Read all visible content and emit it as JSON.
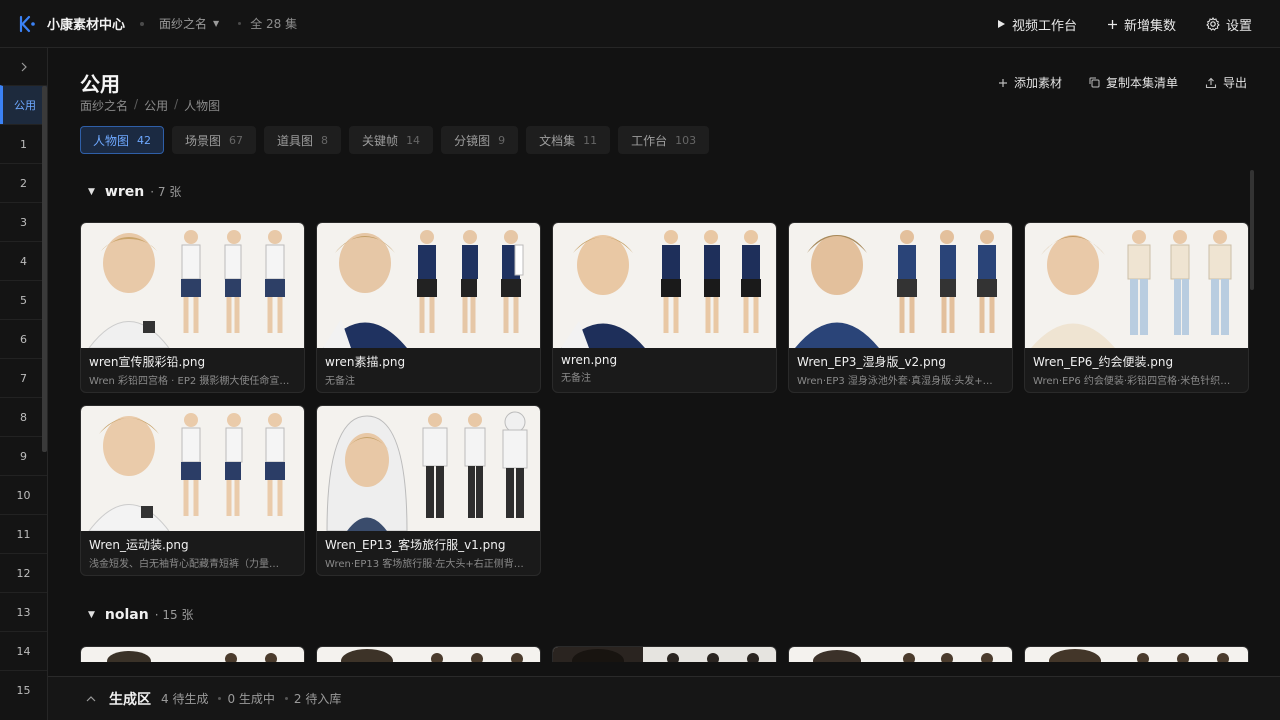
{
  "header": {
    "app_title": "小康素材中心",
    "project": "面纱之名",
    "episodes": "全 28 集",
    "actions": [
      {
        "label": "视频工作台",
        "icon": "play-icon"
      },
      {
        "label": "新增集数",
        "icon": "plus-icon"
      },
      {
        "label": "设置",
        "icon": "gear-icon"
      }
    ]
  },
  "sidebar": {
    "items": [
      "公用",
      "1",
      "2",
      "3",
      "4",
      "5",
      "6",
      "7",
      "8",
      "9",
      "10",
      "11",
      "12",
      "13",
      "14",
      "15"
    ]
  },
  "page": {
    "title": "公用",
    "breadcrumb": [
      "面纱之名",
      "公用",
      "人物图"
    ],
    "actions": [
      {
        "label": "添加素材",
        "icon": "plus-icon"
      },
      {
        "label": "复制本集清单",
        "icon": "copy-icon"
      },
      {
        "label": "导出",
        "icon": "export-icon"
      }
    ]
  },
  "tabs": [
    {
      "label": "人物图",
      "count": "42"
    },
    {
      "label": "场景图",
      "count": "67"
    },
    {
      "label": "道具图",
      "count": "8"
    },
    {
      "label": "关键帧",
      "count": "14"
    },
    {
      "label": "分镜图",
      "count": "9"
    },
    {
      "label": "文档集",
      "count": "11"
    },
    {
      "label": "工作台",
      "count": "103"
    }
  ],
  "groups": [
    {
      "name": "wren",
      "count": "· 7 张",
      "cards": [
        {
          "file": "wren宣传服彩铅.png",
          "note": "Wren 彩铅四宫格 · EP2 摄影棚大使任命宣…"
        },
        {
          "file": "wren素描.png",
          "note": "无备注"
        },
        {
          "file": "wren.png",
          "note": "无备注"
        },
        {
          "file": "Wren_EP3_湿身版_v2.png",
          "note": "Wren·EP3 湿身泳池外套·真湿身版·头发+…"
        },
        {
          "file": "Wren_EP6_约会便装.png",
          "note": "Wren·EP6 约会便装·彩铅四宫格·米色针织…"
        },
        {
          "file": "Wren_运动装.png",
          "note": "浅金短发、白无袖背心配藏青短裤（力量…"
        },
        {
          "file": "Wren_EP13_客场旅行服_v1.png",
          "note": "Wren·EP13 客场旅行服·左大头+右正侧背…"
        }
      ]
    },
    {
      "name": "nolan",
      "count": "· 15 张"
    }
  ],
  "bottom": {
    "title": "生成区",
    "stats": [
      "4 待生成",
      "0 生成中",
      "2 待入库"
    ]
  },
  "colors": {
    "accent": "#3b82f6",
    "background": "#121212"
  }
}
